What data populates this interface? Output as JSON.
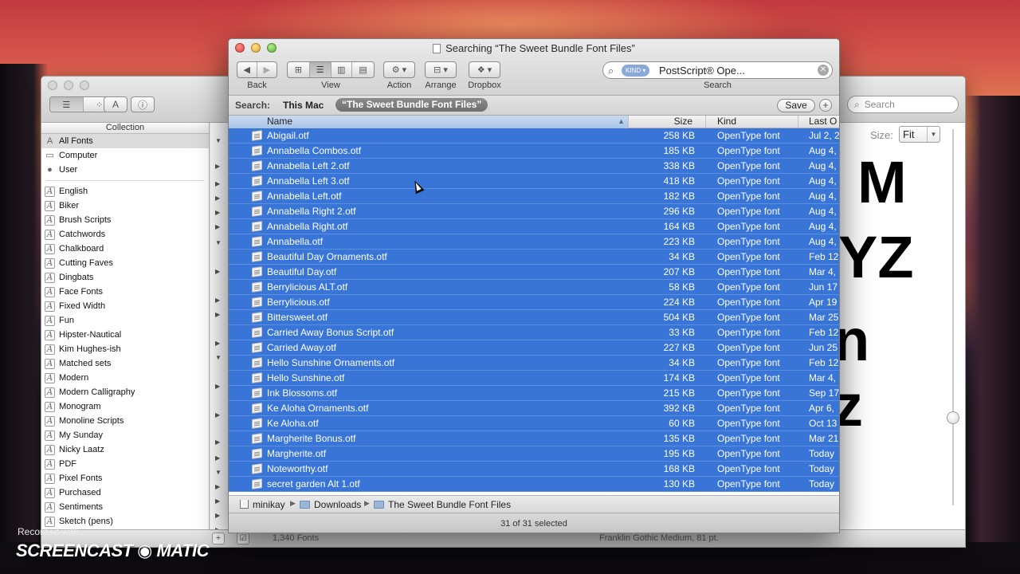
{
  "fontbook": {
    "sidebar_header": "Collection",
    "system_items": [
      {
        "label": "All Fonts",
        "icon": "font-collection-icon",
        "glyph": "A"
      },
      {
        "label": "Computer",
        "icon": "computer-icon",
        "glyph": "▭"
      },
      {
        "label": "User",
        "icon": "user-icon",
        "glyph": "●"
      }
    ],
    "collections": [
      "English",
      "Biker",
      "Brush Scripts",
      "Catchwords",
      "Chalkboard",
      "Cutting Faves",
      "Dingbats",
      "Face Fonts",
      "Fixed Width",
      "Fun",
      "Hipster-Nautical",
      "Kim Hughes-ish",
      "Matched sets",
      "Modern",
      "Modern Calligraphy",
      "Monogram",
      "Monoline Scripts",
      "My Sunday",
      "Nicky Laatz",
      "PDF",
      "Pixel Fonts",
      "Purchased",
      "Sentiments",
      "Sketch (pens)"
    ],
    "search_placeholder": "Search",
    "size_label": "Size:",
    "size_value": "Fit",
    "font_count": "1,340 Fonts",
    "status": "Franklin Gothic Medium, 81 pt.",
    "sample_lines": [
      "M",
      "YZ",
      "n",
      "z"
    ]
  },
  "finder": {
    "title": "Searching “The Sweet Bundle Font Files”",
    "toolbar": {
      "back_label": "Back",
      "view_label": "View",
      "action_label": "Action",
      "arrange_label": "Arrange",
      "dropbox_label": "Dropbox",
      "search_label": "Search"
    },
    "search": {
      "token": "KIND ▾",
      "value": "PostScript® Ope..."
    },
    "scope": {
      "label": "Search:",
      "this_mac": "This Mac",
      "folder": "“The Sweet Bundle Font Files”",
      "save_label": "Save",
      "add_label": "+"
    },
    "columns": {
      "name": "Name",
      "size": "Size",
      "kind": "Kind",
      "last_opened": "Last O"
    },
    "files": [
      {
        "name": "Abigail.otf",
        "size": "258 KB",
        "kind": "OpenType font",
        "date": "Jul 2, 2"
      },
      {
        "name": "Annabella Combos.otf",
        "size": "185 KB",
        "kind": "OpenType font",
        "date": "Aug 4,"
      },
      {
        "name": "Annabella Left 2.otf",
        "size": "338 KB",
        "kind": "OpenType font",
        "date": "Aug 4,"
      },
      {
        "name": "Annabella Left 3.otf",
        "size": "418 KB",
        "kind": "OpenType font",
        "date": "Aug 4,"
      },
      {
        "name": "Annabella Left.otf",
        "size": "182 KB",
        "kind": "OpenType font",
        "date": "Aug 4,"
      },
      {
        "name": "Annabella Right 2.otf",
        "size": "296 KB",
        "kind": "OpenType font",
        "date": "Aug 4,"
      },
      {
        "name": "Annabella Right.otf",
        "size": "164 KB",
        "kind": "OpenType font",
        "date": "Aug 4,"
      },
      {
        "name": "Annabella.otf",
        "size": "223 KB",
        "kind": "OpenType font",
        "date": "Aug 4,"
      },
      {
        "name": "Beautiful Day Ornaments.otf",
        "size": "34 KB",
        "kind": "OpenType font",
        "date": "Feb 12"
      },
      {
        "name": "Beautiful Day.otf",
        "size": "207 KB",
        "kind": "OpenType font",
        "date": "Mar 4,"
      },
      {
        "name": "Berrylicious ALT.otf",
        "size": "58 KB",
        "kind": "OpenType font",
        "date": "Jun 17"
      },
      {
        "name": "Berrylicious.otf",
        "size": "224 KB",
        "kind": "OpenType font",
        "date": "Apr 19"
      },
      {
        "name": "Bittersweet.otf",
        "size": "504 KB",
        "kind": "OpenType font",
        "date": "Mar 25"
      },
      {
        "name": "Carried Away Bonus Script.otf",
        "size": "33 KB",
        "kind": "OpenType font",
        "date": "Feb 12"
      },
      {
        "name": "Carried Away.otf",
        "size": "227 KB",
        "kind": "OpenType font",
        "date": "Jun 25"
      },
      {
        "name": "Hello Sunshine Ornaments.otf",
        "size": "34 KB",
        "kind": "OpenType font",
        "date": "Feb 12"
      },
      {
        "name": "Hello Sunshine.otf",
        "size": "174 KB",
        "kind": "OpenType font",
        "date": "Mar 4,"
      },
      {
        "name": "Ink Blossoms.otf",
        "size": "215 KB",
        "kind": "OpenType font",
        "date": "Sep 17"
      },
      {
        "name": "Ke Aloha Ornaments.otf",
        "size": "392 KB",
        "kind": "OpenType font",
        "date": "Apr 6,"
      },
      {
        "name": "Ke Aloha.otf",
        "size": "60 KB",
        "kind": "OpenType font",
        "date": "Oct 13"
      },
      {
        "name": "Margherite Bonus.otf",
        "size": "135 KB",
        "kind": "OpenType font",
        "date": "Mar 21"
      },
      {
        "name": "Margherite.otf",
        "size": "195 KB",
        "kind": "OpenType font",
        "date": "Today"
      },
      {
        "name": "Noteworthy.otf",
        "size": "168 KB",
        "kind": "OpenType font",
        "date": "Today"
      },
      {
        "name": "secret garden Alt 1.otf",
        "size": "130 KB",
        "kind": "OpenType font",
        "date": "Today"
      }
    ],
    "path": [
      "minikay",
      "Downloads",
      "The Sweet Bundle Font Files"
    ],
    "status": "31 of 31 selected"
  },
  "watermark": {
    "recorded": "Recorded with",
    "brand": "SCREENCAST ◉ MATIC"
  },
  "colors": {
    "selection": "#3875d7",
    "window_chrome": "#d2d2d2"
  }
}
